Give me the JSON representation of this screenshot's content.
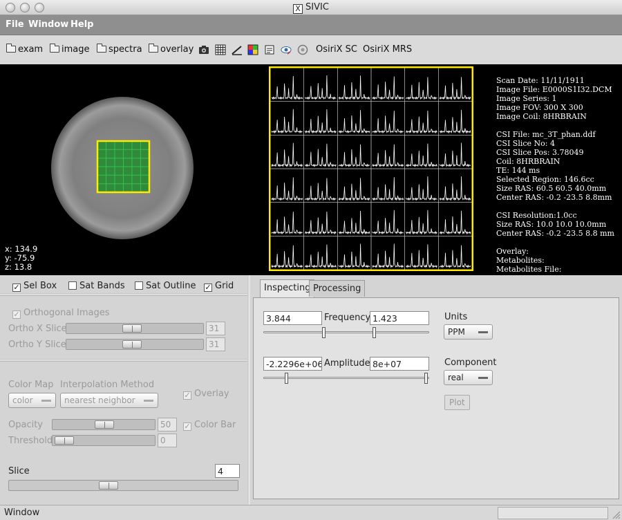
{
  "window": {
    "title": "SIVIC",
    "x_badge": "X"
  },
  "menubar": {
    "file": "File",
    "window": "Window",
    "help": "Help"
  },
  "toolbar": {
    "exam": "exam",
    "image": "image",
    "spectra": "spectra",
    "overlay": "overlay",
    "icons": [
      "camera-icon",
      "grid-icon",
      "ruler-icon",
      "color-icon",
      "notes-icon",
      "eye-icon",
      "orbit-icon"
    ],
    "osirix_sc": "OsiriX SC",
    "osirix_mrs": "OsiriX MRS"
  },
  "readout": {
    "x": "x: 134.9",
    "y": "y: -75.9",
    "z": "z: 13.8"
  },
  "spectra_grid": {
    "rows": 6,
    "cols": 6
  },
  "info": {
    "scan_date": "Scan Date:  11/11/1911",
    "image_file": "Image File:  E0000S1I32.DCM",
    "image_series": "Image Series:  1",
    "image_fov": "Image FOV:  300 X 300",
    "image_coil": "Image Coil:  8HRBRAIN",
    "csi_file": "CSI File: mc_3T_phan.ddf",
    "csi_slice_no": "CSI Slice No:  4",
    "csi_slice_pos": "CSI Slice Pos:  3.78049",
    "coil": "Coil:  8HRBRAIN",
    "te": "TE:  144 ms",
    "selected_region": "Selected Region:  146.6cc",
    "size_ras": "Size RAS: 60.5 60.5 40.0mm",
    "center_ras": "Center RAS: -0.2 -23.5 8.8mm",
    "csi_resolution": "CSI Resolution:1.0cc",
    "size_ras2": "Size RAS: 10.0 10.0 10.0mm",
    "center_ras2": "Center RAS: -0.2 -23.5 8.8 mm",
    "overlay": "Overlay:",
    "metabolites": "Metabolites:",
    "metabolites_file": "Metabolites File:"
  },
  "left": {
    "sel_box": "Sel Box",
    "sat_bands": "Sat Bands",
    "sat_outline": "Sat Outline",
    "grid": "Grid",
    "orthogonal": "Orthogonal Images",
    "ortho_x": "Ortho X Slice",
    "ortho_x_val": "31",
    "ortho_y": "Ortho Y Slice",
    "ortho_y_val": "31",
    "color_map": "Color Map",
    "color_map_value": "color",
    "interp": "Interpolation Method",
    "interp_value": "nearest neighbor",
    "overlay": "Overlay",
    "color_bar": "Color Bar",
    "opacity": "Opacity",
    "opacity_val": "50",
    "threshold": "Threshold",
    "threshold_val": "0",
    "slice": "Slice",
    "slice_val": "4"
  },
  "tabs": {
    "inspecting": "Inspecting",
    "processing": "Processing"
  },
  "inspect": {
    "freq_min": "3.844",
    "freq_label": "Frequency",
    "freq_max": "1.423",
    "amp_min": "-2.2296e+06",
    "amp_label": "Amplitude",
    "amp_max": "8e+07",
    "units_label": "Units",
    "units_value": "PPM",
    "component_label": "Component",
    "component_value": "real",
    "plot": "Plot"
  },
  "status": {
    "text": "Window"
  }
}
